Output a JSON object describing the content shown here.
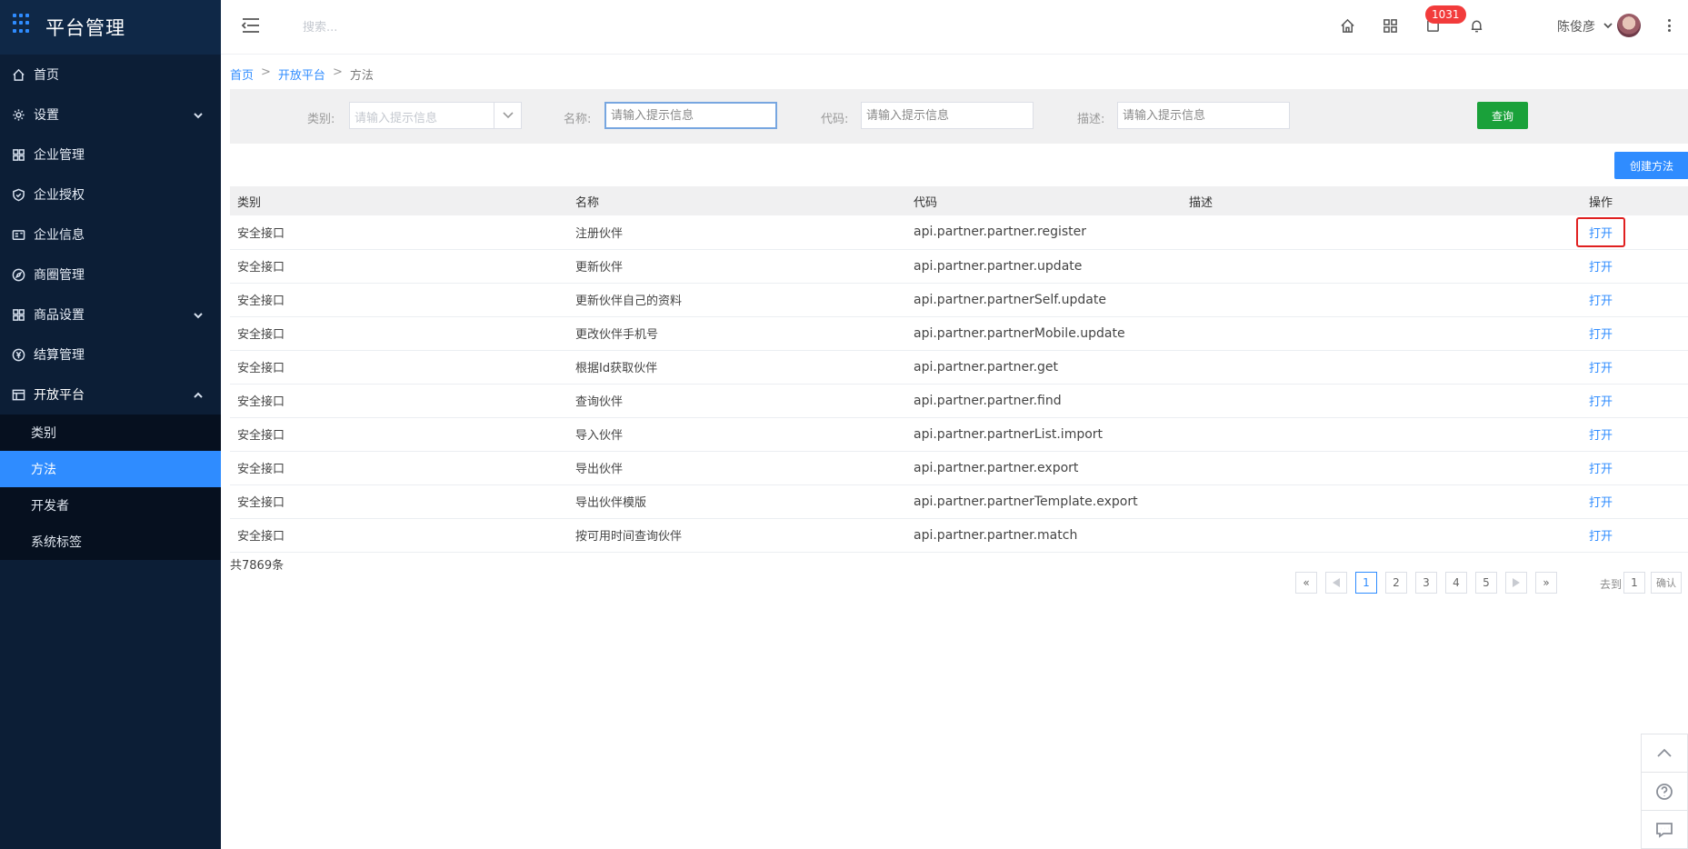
{
  "app": {
    "title": "平台管理"
  },
  "sidebar": {
    "items": [
      {
        "label": "首页",
        "icon": "home-icon"
      },
      {
        "label": "设置",
        "icon": "gear-icon",
        "expandable": true
      },
      {
        "label": "企业管理",
        "icon": "grid-icon"
      },
      {
        "label": "企业授权",
        "icon": "shield-check-icon"
      },
      {
        "label": "企业信息",
        "icon": "id-card-icon"
      },
      {
        "label": "商圈管理",
        "icon": "compass-icon"
      },
      {
        "label": "商品设置",
        "icon": "apps-icon",
        "expandable": true
      },
      {
        "label": "结算管理",
        "icon": "yen-icon"
      },
      {
        "label": "开放平台",
        "icon": "table-icon",
        "expandable": true,
        "open": true
      }
    ],
    "submenu": [
      {
        "label": "类别"
      },
      {
        "label": "方法",
        "active": true
      },
      {
        "label": "开发者"
      },
      {
        "label": "系统标签"
      }
    ]
  },
  "header": {
    "search_placeholder": "搜索...",
    "badge_count": "1031",
    "user_name": "陈俊彦"
  },
  "breadcrumb": {
    "home": "首页",
    "section": "开放平台",
    "current": "方法",
    "sep": ">"
  },
  "filter": {
    "category_label": "类别:",
    "category_placeholder": "请输入提示信息",
    "name_label": "名称:",
    "name_placeholder": "请输入提示信息",
    "code_label": "代码:",
    "code_placeholder": "请输入提示信息",
    "desc_label": "描述:",
    "desc_placeholder": "请输入提示信息",
    "query_button": "查询"
  },
  "create_button": "创建方法",
  "table": {
    "headers": {
      "category": "类别",
      "name": "名称",
      "code": "代码",
      "desc": "描述",
      "op": "操作"
    },
    "rows": [
      {
        "category": "安全接口",
        "name": "注册伙伴",
        "code": "api.partner.partner.register",
        "desc": "",
        "op": "打开"
      },
      {
        "category": "安全接口",
        "name": "更新伙伴",
        "code": "api.partner.partner.update",
        "desc": "",
        "op": "打开"
      },
      {
        "category": "安全接口",
        "name": "更新伙伴自己的资料",
        "code": "api.partner.partnerSelf.update",
        "desc": "",
        "op": "打开"
      },
      {
        "category": "安全接口",
        "name": "更改伙伴手机号",
        "code": "api.partner.partnerMobile.update",
        "desc": "",
        "op": "打开"
      },
      {
        "category": "安全接口",
        "name": "根据Id获取伙伴",
        "code": "api.partner.partner.get",
        "desc": "",
        "op": "打开"
      },
      {
        "category": "安全接口",
        "name": "查询伙伴",
        "code": "api.partner.partner.find",
        "desc": "",
        "op": "打开"
      },
      {
        "category": "安全接口",
        "name": "导入伙伴",
        "code": "api.partner.partnerList.import",
        "desc": "",
        "op": "打开"
      },
      {
        "category": "安全接口",
        "name": "导出伙伴",
        "code": "api.partner.partner.export",
        "desc": "",
        "op": "打开"
      },
      {
        "category": "安全接口",
        "name": "导出伙伴模版",
        "code": "api.partner.partnerTemplate.export",
        "desc": "",
        "op": "打开"
      },
      {
        "category": "安全接口",
        "name": "按可用时间查询伙伴",
        "code": "api.partner.partner.match",
        "desc": "",
        "op": "打开"
      }
    ]
  },
  "pagination": {
    "total": "共7869条",
    "first": "«",
    "last": "»",
    "pages": [
      "1",
      "2",
      "3",
      "4",
      "5"
    ],
    "current": "1",
    "goto_label": "去到",
    "goto_value": "1",
    "confirm": "确认"
  },
  "colors": {
    "sidebar_bg": "#0c1e36",
    "accent": "#2f8cff",
    "query_green": "#1aa13a",
    "badge_red": "#f23b3b"
  }
}
